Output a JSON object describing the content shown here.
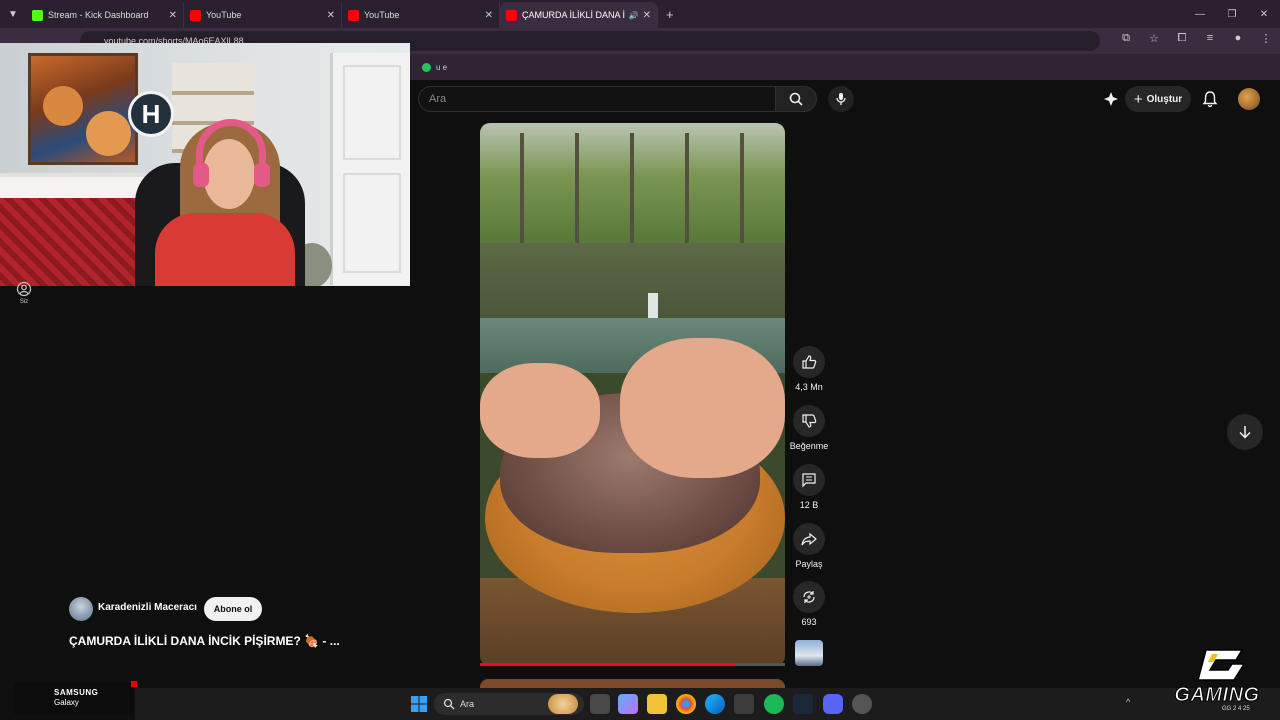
{
  "browser": {
    "tabs": [
      {
        "title": "Stream - Kick Dashboard",
        "favicon": "kick-icon",
        "color": "#53fc18"
      },
      {
        "title": "YouTube",
        "favicon": "youtube-icon",
        "color": "#ff0000"
      },
      {
        "title": "YouTube",
        "favicon": "youtube-icon",
        "color": "#ff0000"
      },
      {
        "title": "ÇAMURDA İLİKLİ DANA İNC",
        "favicon": "youtube-icon",
        "color": "#ff0000",
        "active": true
      }
    ],
    "url": "youtube.com/shorts/MAo6EAXlL88",
    "bookmark_label": "u e"
  },
  "youtube": {
    "search_placeholder": "Ara",
    "create_label": "Oluştur"
  },
  "sidebar": {
    "you_label": "Siz"
  },
  "short": {
    "channel_name": "Karadenizli Maceracı",
    "subscribe_label": "Abone ol",
    "title": "ÇAMURDA İLİKLİ DANA İNCİK PİŞİRME?",
    "title_suffix": "- ...",
    "progress": 0.84,
    "likes": "4,3 Mn",
    "dislike_label": "Beğenme",
    "comments": "12 B",
    "share_label": "Paylaş",
    "remixes": "693"
  },
  "overlay": {
    "samsung_brand": "SAMSUNG",
    "samsung_model": "Galaxy",
    "gaming_logo": "GAMING",
    "gaming_sub": "GG 2 4 25"
  },
  "taskbar": {
    "search_placeholder": "Ara"
  }
}
